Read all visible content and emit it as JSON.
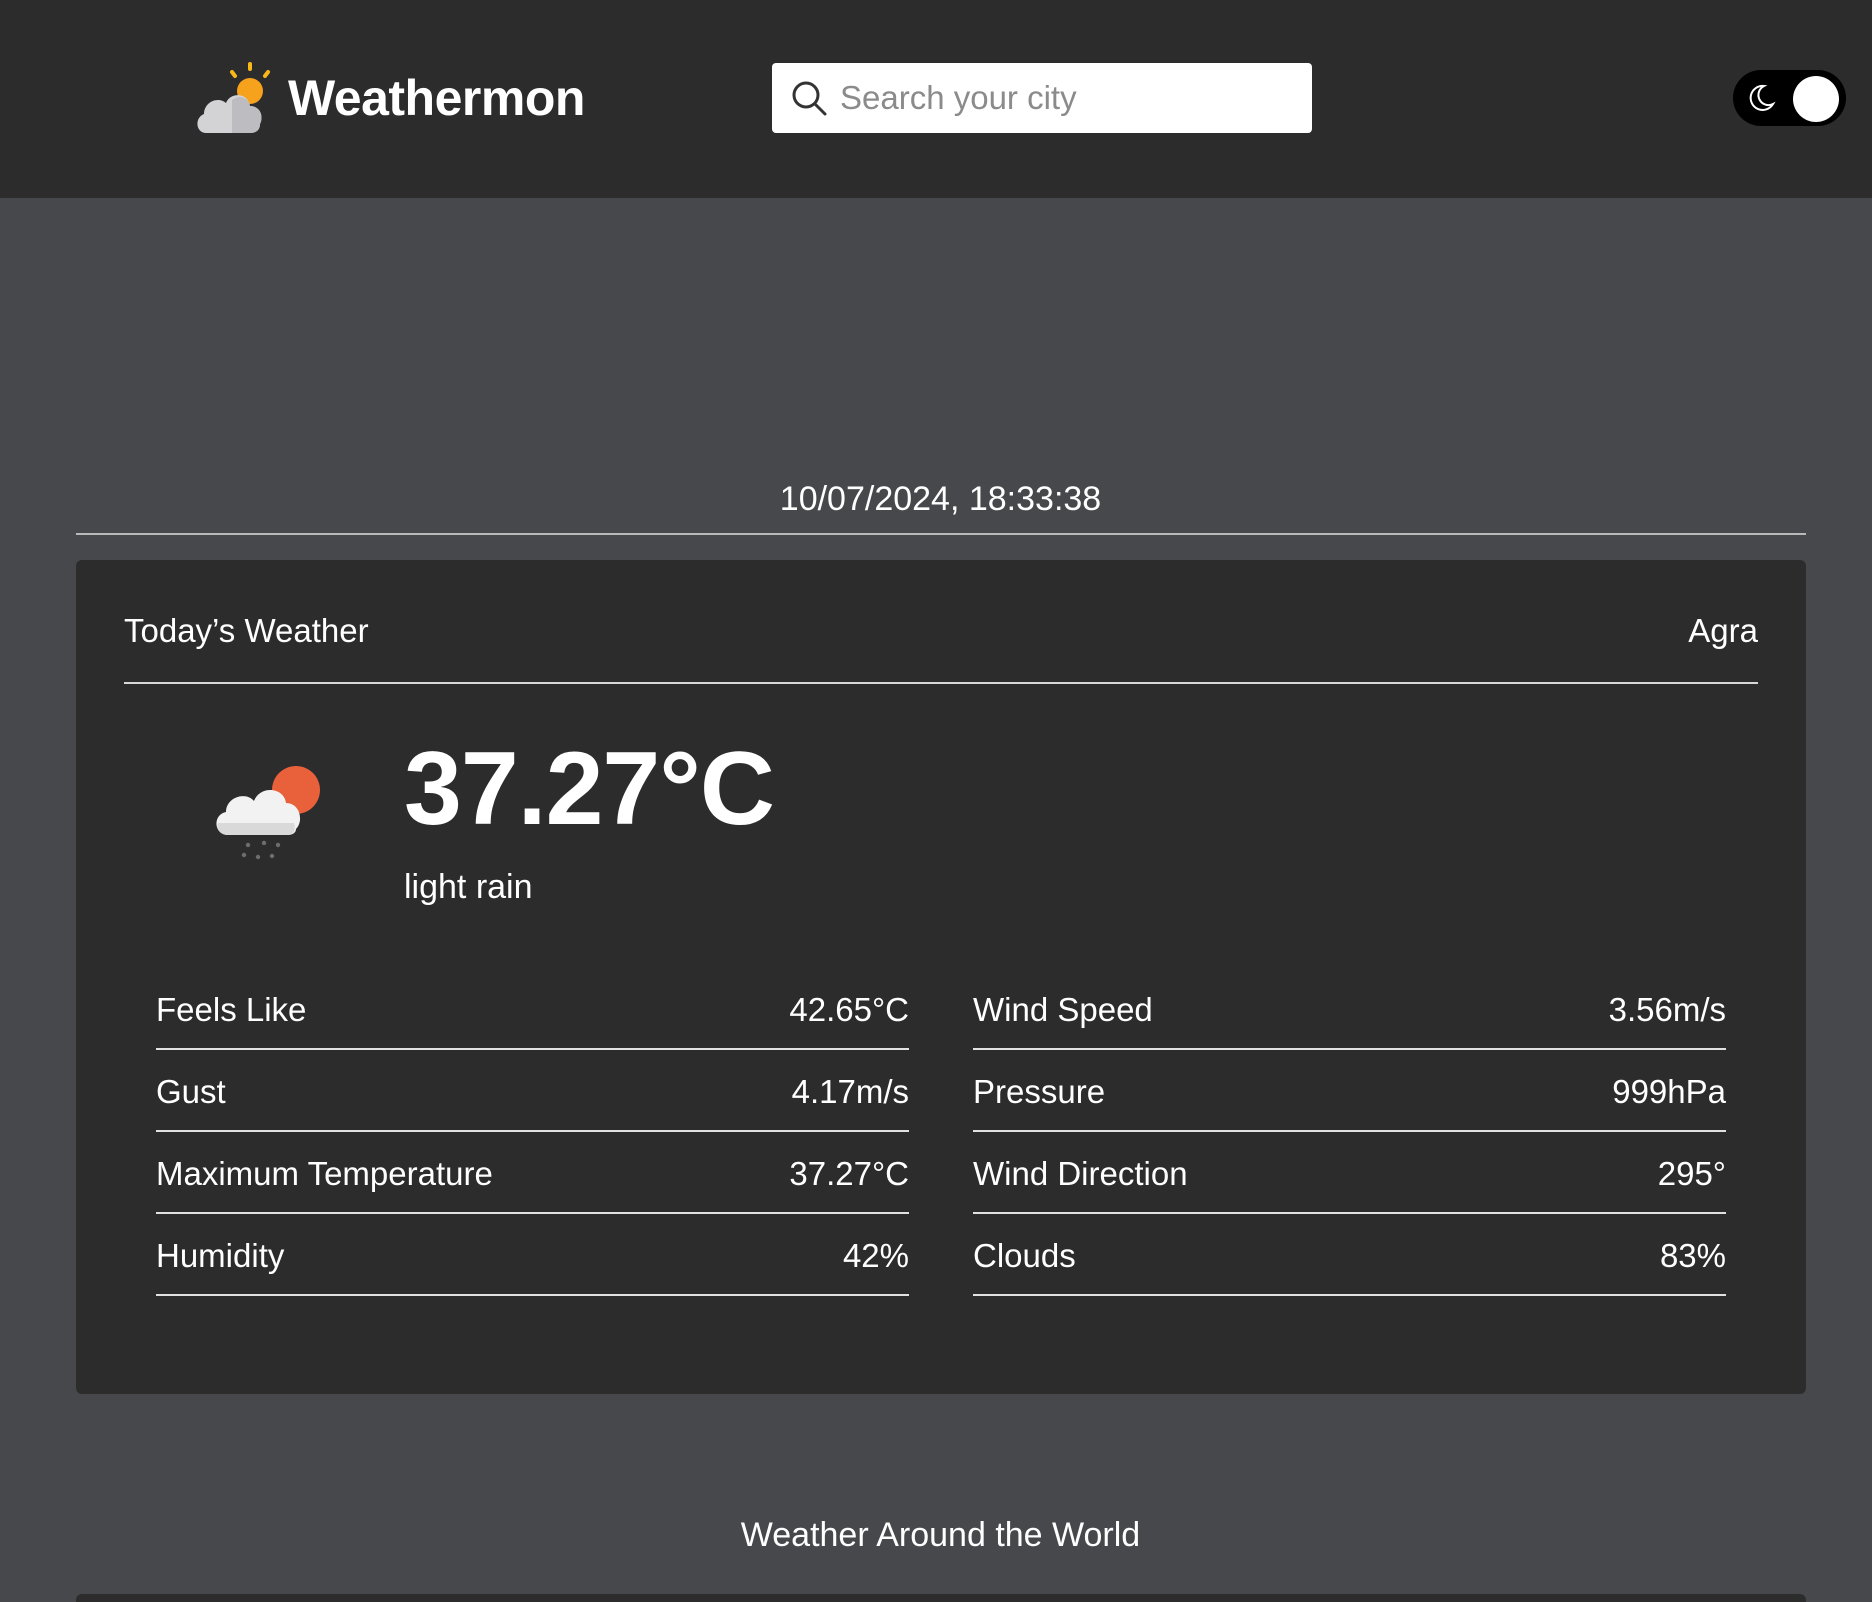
{
  "header": {
    "brand_name": "Weathermon",
    "logo_icon": "cloud-sun-logo-icon",
    "search": {
      "placeholder": "Search your city",
      "value": "",
      "icon": "search-icon"
    },
    "theme_toggle": {
      "icon": "moon-icon",
      "state": "dark"
    }
  },
  "datetime": "10/07/2024, 18:33:38",
  "today": {
    "title": "Today’s Weather",
    "city": "Agra",
    "icon": "cloud-sun-rain-icon",
    "temperature": "37.27°C",
    "description": "light rain",
    "stats_left": [
      {
        "label": "Feels Like",
        "value": "42.65°C"
      },
      {
        "label": "Gust",
        "value": "4.17m/s"
      },
      {
        "label": "Maximum Temperature",
        "value": "37.27°C"
      },
      {
        "label": "Humidity",
        "value": "42%"
      }
    ],
    "stats_right": [
      {
        "label": "Wind Speed",
        "value": "3.56m/s"
      },
      {
        "label": "Pressure",
        "value": "999hPa"
      },
      {
        "label": "Wind Direction",
        "value": "295°"
      },
      {
        "label": "Clouds",
        "value": "83%"
      }
    ]
  },
  "world": {
    "title": "Weather Around the World"
  },
  "colors": {
    "page_background": "#47484c",
    "surface": "#2c2c2d",
    "text": "#ffffff",
    "sun_accent": "#f6a21d",
    "sun_icon_accent": "#e8613a"
  }
}
